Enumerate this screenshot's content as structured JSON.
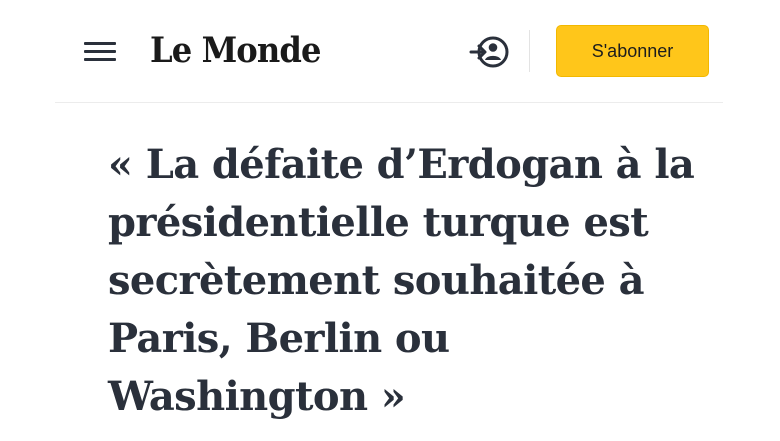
{
  "header": {
    "menu_icon": "hamburger-menu-icon",
    "logo_text": "Le Monde",
    "login_icon": "account-login-icon",
    "subscribe_label": "S'abonner"
  },
  "article": {
    "headline": "« La défaite d’Erdogan à la présidentielle turque est secrètement souhaitée à Paris, Berlin ou Washington »"
  },
  "colors": {
    "subscribe_background": "#ffc61a",
    "headline_text": "#2a303b",
    "icon_color": "#2a303b"
  }
}
